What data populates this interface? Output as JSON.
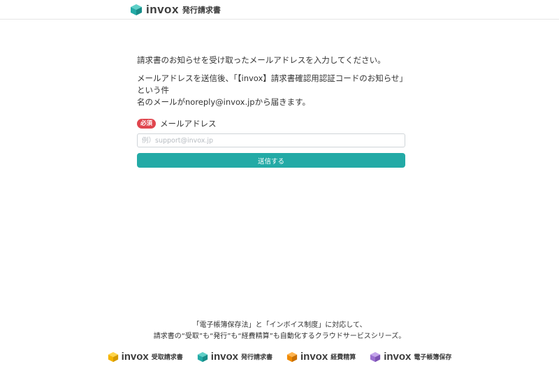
{
  "header": {
    "brand_word": "invox",
    "brand_sub": "発行請求書"
  },
  "main": {
    "lead": "請求書のお知らせを受け取ったメールアドレスを入力してください。",
    "note_line1": "メールアドレスを送信後、「【invox】請求書確認用認証コードのお知らせ」という件",
    "note_line2": "名のメールがnoreply@invox.jpから届きます。",
    "required_badge": "必須",
    "email_label": "メールアドレス",
    "email_placeholder": "例）support@invox.jp",
    "email_value": "",
    "submit_label": "送信する"
  },
  "footer": {
    "line1": "「電子帳簿保存法」と「インボイス制度」に対応して、",
    "line2": "請求書の“受取”も“発行”も“経費精算”も自動化するクラウドサービスシリーズ。",
    "products": [
      {
        "word": "invox",
        "sub": "受取請求書",
        "color": "#f5b400"
      },
      {
        "word": "invox",
        "sub": "発行請求書",
        "color": "#23aaa6"
      },
      {
        "word": "invox",
        "sub": "経費精算",
        "color": "#f08a00"
      },
      {
        "word": "invox",
        "sub": "電子帳簿保存",
        "color": "#9b6fd0"
      }
    ]
  },
  "colors": {
    "accent": "#23aaa6",
    "required": "#e0464e"
  }
}
